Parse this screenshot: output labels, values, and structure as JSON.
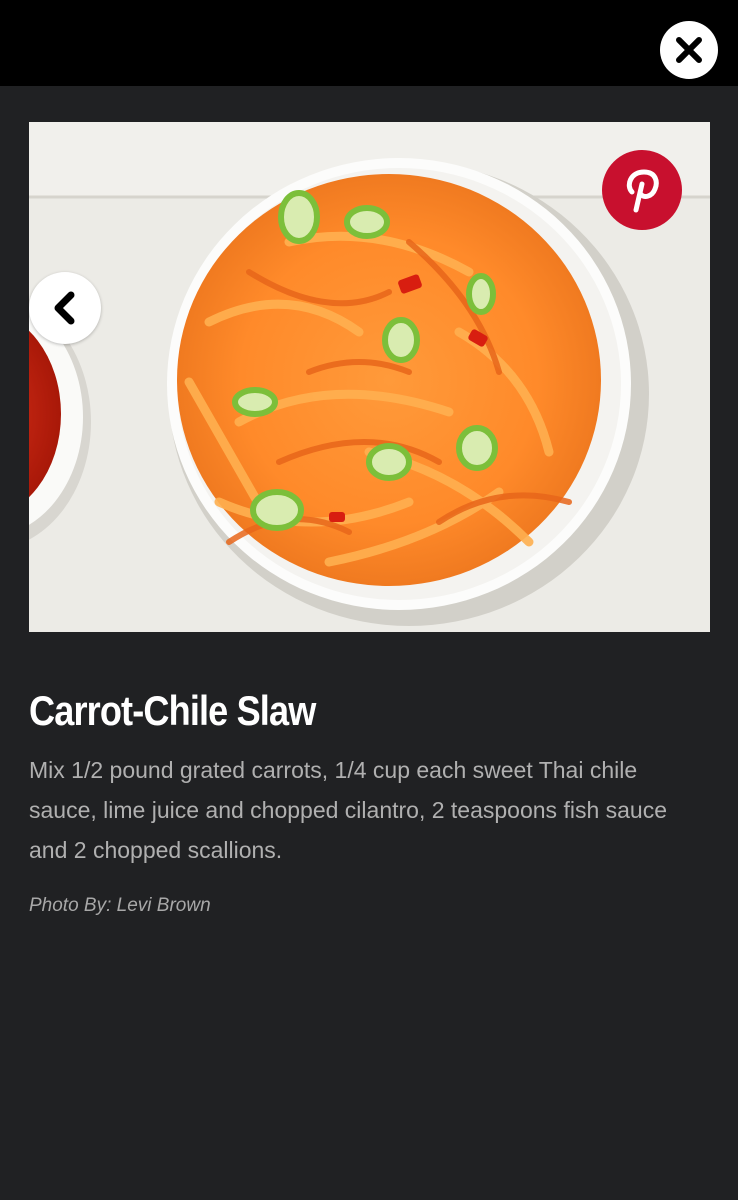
{
  "slide": {
    "title": "Carrot-Chile Slaw",
    "description": "Mix 1/2 pound grated carrots, 1/4 cup each sweet Thai chile sauce, lime juice and chopped cilantro, 2 teaspoons fish sauce and 2 chopped scallions.",
    "credit": "Photo By: Levi Brown"
  },
  "controls": {
    "close_icon": "close-icon",
    "prev_icon": "chevron-left-icon",
    "pin_icon": "pinterest-icon"
  },
  "colors": {
    "page_background": "#202123",
    "top_bar": "#000000",
    "pinterest_red": "#c8102e",
    "title": "#ffffff",
    "description": "#b0b0b0"
  }
}
